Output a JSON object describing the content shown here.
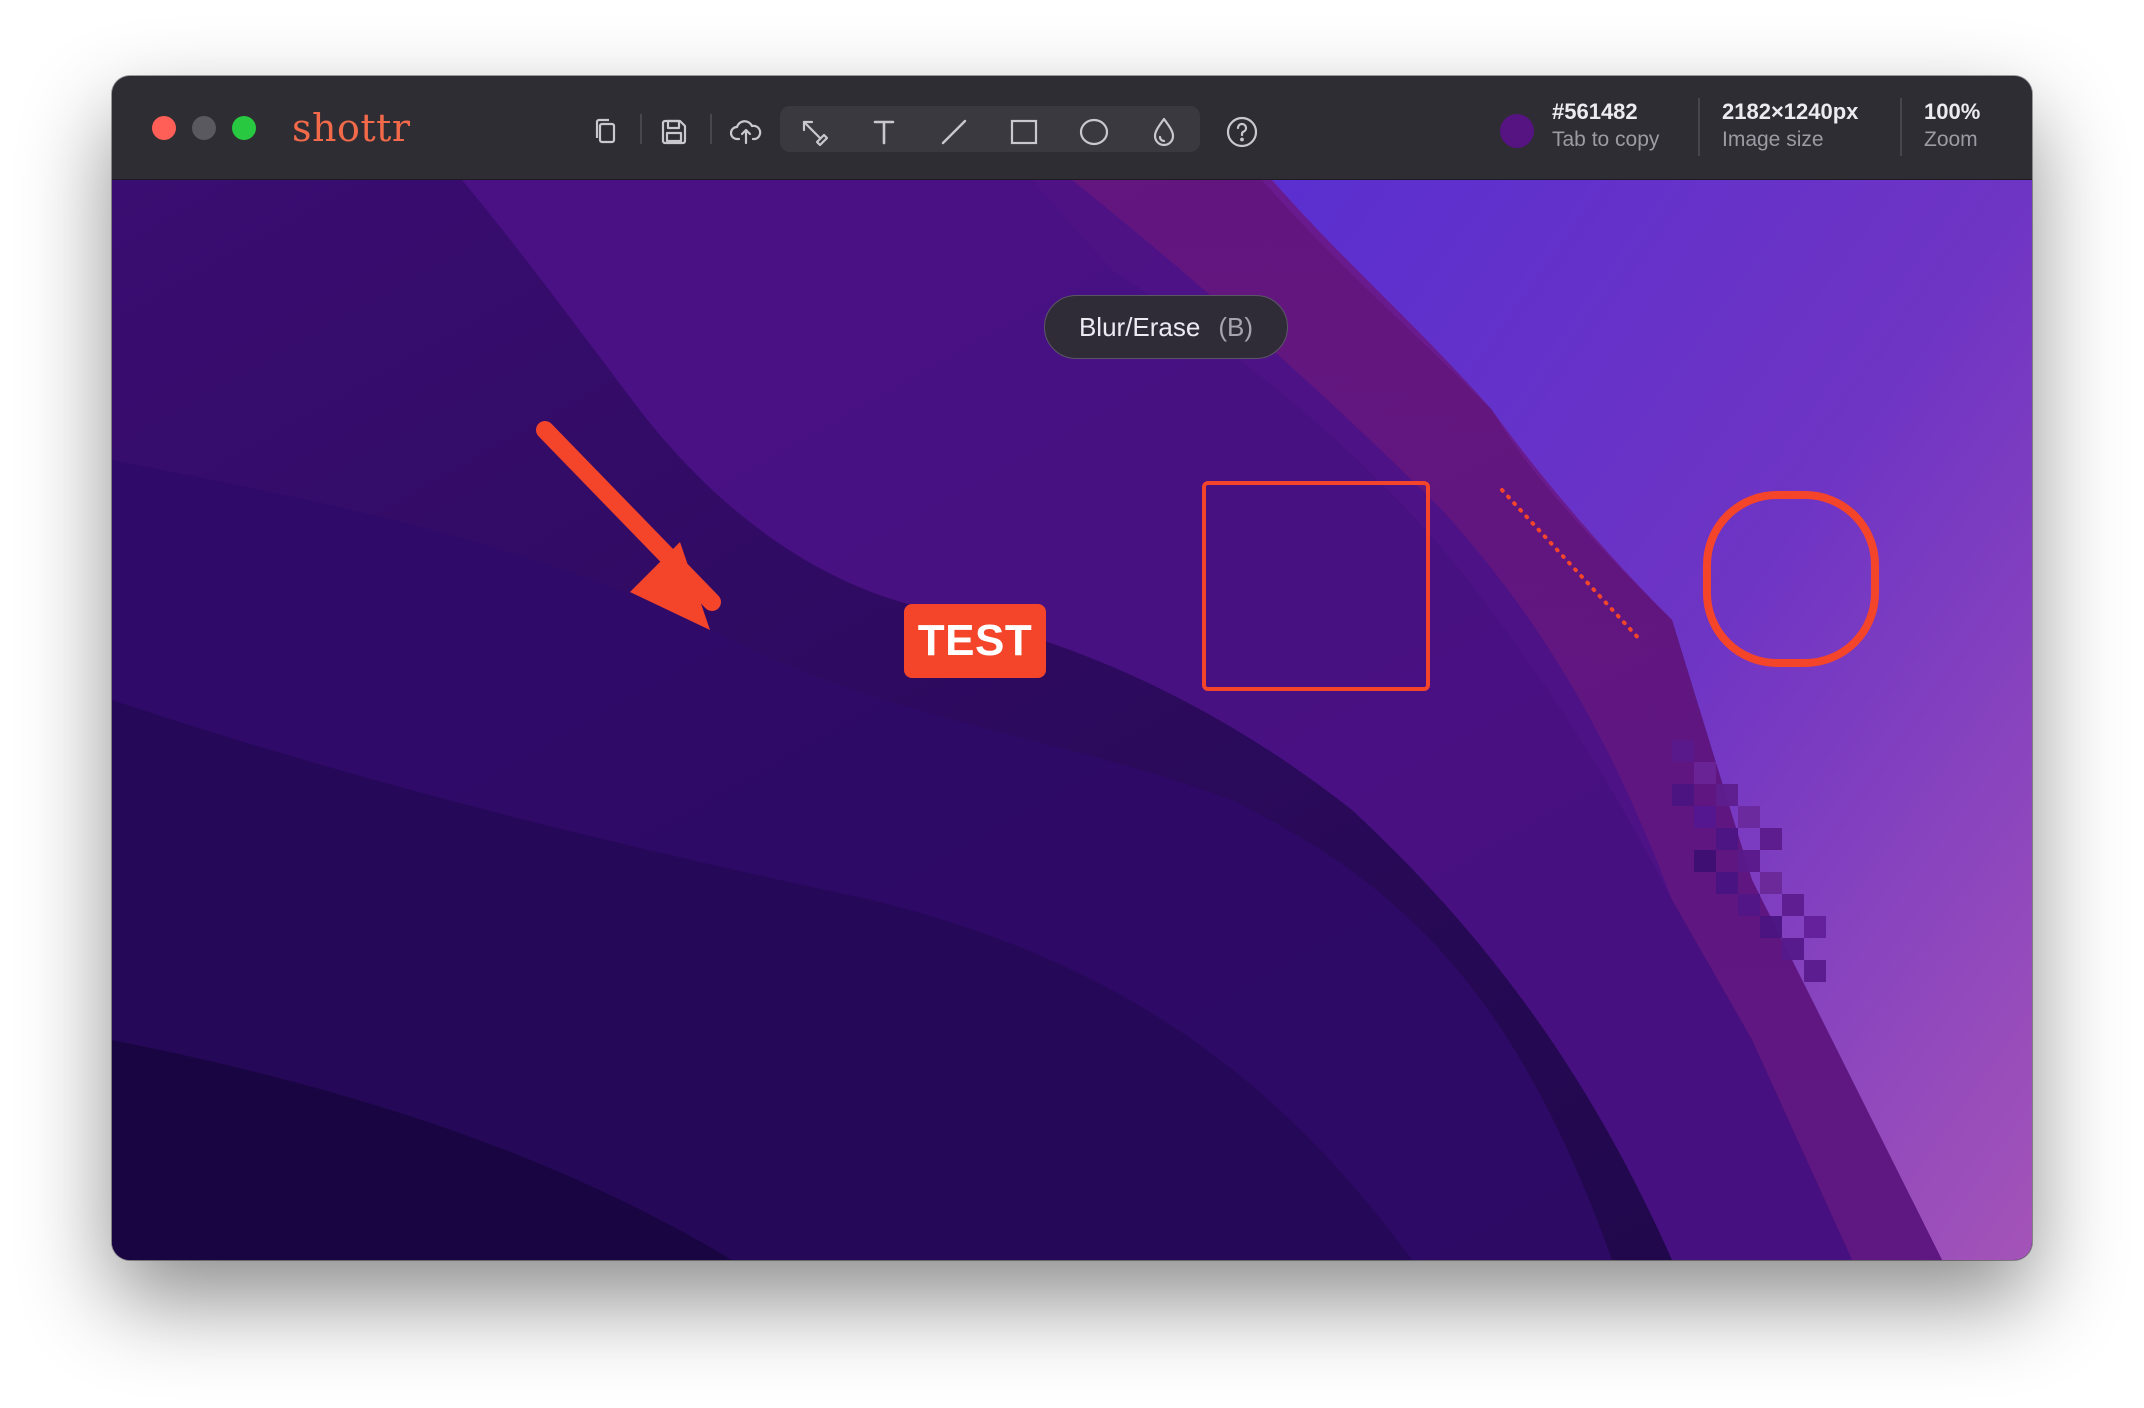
{
  "app": {
    "name": "shottr"
  },
  "colors": {
    "accent": "#f4452a",
    "brand": "#f26a4a",
    "titlebar": "#2e2d33"
  },
  "toolbar": {
    "left_tools": [
      "copy-icon",
      "save-icon",
      "cloud-upload-icon",
      "crop-pages-icon"
    ],
    "annotation_tools": [
      "arrow-pen-icon",
      "text-icon",
      "line-icon",
      "rectangle-icon",
      "circle-icon",
      "blur-erase-icon"
    ],
    "help": "help-icon"
  },
  "info": {
    "color_hex": "#561482",
    "color_hint": "Tab to copy",
    "image_size": "2182×1240px",
    "image_size_label": "Image size",
    "zoom": "100%",
    "zoom_label": "Zoom"
  },
  "tooltip": {
    "label": "Blur/Erase",
    "shortcut": "(B)"
  },
  "annotations": {
    "text_label": "TEST"
  }
}
